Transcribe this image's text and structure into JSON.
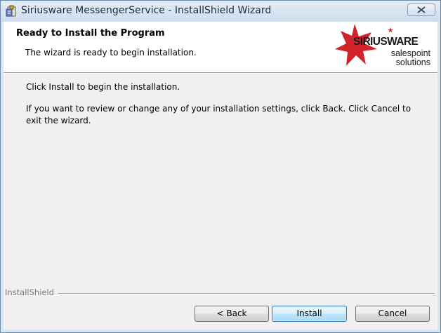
{
  "window": {
    "title": "Siriusware MessengerService - InstallShield Wizard",
    "app_icon": "installer-icon",
    "close_icon": "close-icon"
  },
  "header": {
    "title": "Ready to Install the Program",
    "subtitle": "The wizard is ready to begin installation."
  },
  "logo": {
    "brand": "SIRIUSWARE",
    "line1": "salespoint",
    "line2": "solutions",
    "accent_color": "#d2232a"
  },
  "body": {
    "paragraph1": "Click Install to begin the installation.",
    "paragraph2": "If you want to review or change any of your installation settings, click Back. Click Cancel to exit the wizard."
  },
  "footer": {
    "label": "InstallShield"
  },
  "buttons": {
    "back": "< Back",
    "install": "Install",
    "cancel": "Cancel"
  }
}
